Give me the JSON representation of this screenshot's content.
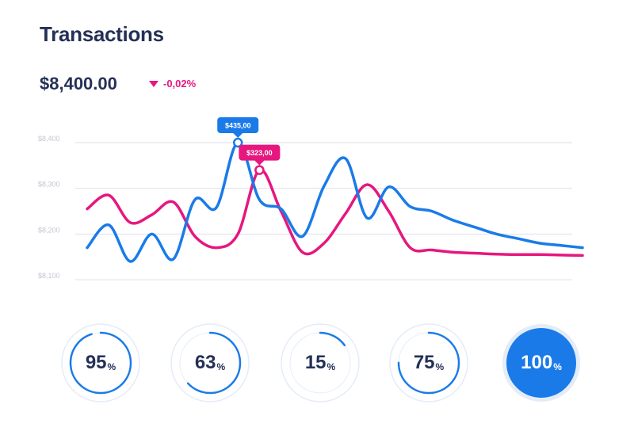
{
  "header": {
    "title": "Transactions",
    "amount": "$8,400.00",
    "change": "-0,02%",
    "change_color": "#e6177f",
    "change_icon": "triangle-down-icon"
  },
  "chart_data": {
    "type": "line",
    "title": "",
    "xlabel": "",
    "ylabel": "",
    "ylim": [
      8100,
      8400
    ],
    "yticks": [
      8100,
      8200,
      8300,
      8400
    ],
    "ytick_labels": [
      "$8,100",
      "$8,200",
      "$8,300",
      "$8,400"
    ],
    "grid": true,
    "x": [
      0,
      1,
      2,
      3,
      4,
      5,
      6,
      7,
      8,
      9,
      10,
      11,
      12,
      13,
      14,
      15,
      16,
      17,
      18,
      19,
      20,
      21,
      22,
      23
    ],
    "series": [
      {
        "color": "#1a7be8",
        "values": [
          8170,
          8220,
          8140,
          8200,
          8145,
          8275,
          8258,
          8400,
          8275,
          8255,
          8195,
          8305,
          8365,
          8235,
          8303,
          8260,
          8250,
          8230,
          8215,
          8200,
          8190,
          8180,
          8175,
          8170
        ],
        "callout": {
          "index": 7,
          "label": "$435,00"
        }
      },
      {
        "color": "#e6177f",
        "values": [
          8255,
          8285,
          8225,
          8242,
          8270,
          8195,
          8170,
          8200,
          8340,
          8250,
          8160,
          8180,
          8245,
          8308,
          8250,
          8170,
          8165,
          8160,
          8158,
          8156,
          8155,
          8155,
          8154,
          8153
        ],
        "callout": {
          "index": 8,
          "label": "$323,00"
        }
      }
    ]
  },
  "gauges": [
    {
      "value": 95,
      "num": "95",
      "unit": "%"
    },
    {
      "value": 63,
      "num": "63",
      "unit": "%"
    },
    {
      "value": 15,
      "num": "15",
      "unit": "%"
    },
    {
      "value": 75,
      "num": "75",
      "unit": "%"
    },
    {
      "value": 100,
      "num": "100",
      "unit": "%"
    }
  ],
  "colors": {
    "accent_blue": "#1a7be8",
    "accent_pink": "#e6177f",
    "text_dark": "#243056",
    "grid": "#dde1ea",
    "tick": "#c2c6d0",
    "ring_bg": "#e4ecf8"
  }
}
